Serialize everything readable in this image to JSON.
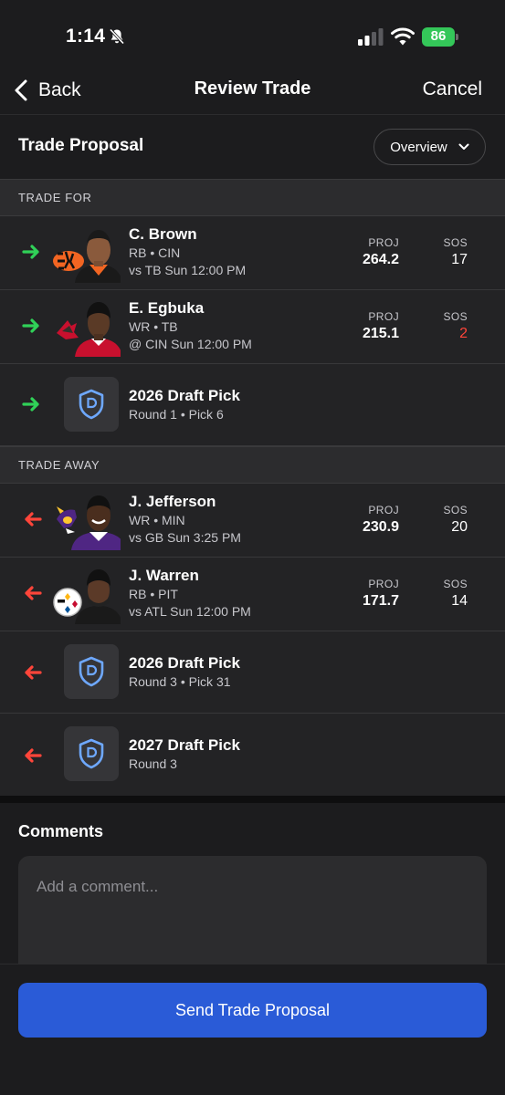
{
  "status_bar": {
    "time": "1:14",
    "battery": "86"
  },
  "nav": {
    "back_label": "Back",
    "title": "Review Trade",
    "cancel_label": "Cancel"
  },
  "proposal": {
    "title": "Trade Proposal",
    "view_selector": "Overview"
  },
  "trade_for": {
    "header": "TRADE FOR",
    "players": [
      {
        "name": "C. Brown",
        "pos_team": "RB • CIN",
        "game": "vs TB Sun 12:00 PM",
        "proj_label": "PROJ",
        "proj": "264.2",
        "sos_label": "SOS",
        "sos": "17",
        "team_logo": "bengals-logo"
      },
      {
        "name": "E. Egbuka",
        "pos_team": "WR • TB",
        "game": "@ CIN Sun 12:00 PM",
        "proj_label": "PROJ",
        "proj": "215.1",
        "sos_label": "SOS",
        "sos": "2",
        "team_logo": "buccaneers-logo"
      }
    ],
    "picks": [
      {
        "title": "2026 Draft Pick",
        "sub": "Round 1 • Pick 6"
      }
    ]
  },
  "trade_away": {
    "header": "TRADE AWAY",
    "players": [
      {
        "name": "J. Jefferson",
        "pos_team": "WR • MIN",
        "game": "vs GB Sun 3:25 PM",
        "proj_label": "PROJ",
        "proj": "230.9",
        "sos_label": "SOS",
        "sos": "20",
        "team_logo": "vikings-logo"
      },
      {
        "name": "J. Warren",
        "pos_team": "RB • PIT",
        "game": "vs ATL Sun 12:00 PM",
        "proj_label": "PROJ",
        "proj": "171.7",
        "sos_label": "SOS",
        "sos": "14",
        "team_logo": "steelers-logo"
      }
    ],
    "picks": [
      {
        "title": "2026 Draft Pick",
        "sub": "Round 3 • Pick 31"
      },
      {
        "title": "2027 Draft Pick",
        "sub": "Round 3"
      }
    ]
  },
  "comments": {
    "title": "Comments",
    "placeholder": "Add a comment..."
  },
  "footer": {
    "send_label": "Send Trade Proposal"
  },
  "colors": {
    "incoming_arrow": "#30d158",
    "outgoing_arrow": "#ff453a",
    "primary_button": "#2a5bd7",
    "hard_sos": "#ff453a"
  }
}
